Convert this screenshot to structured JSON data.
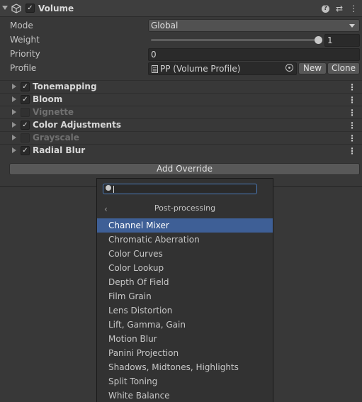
{
  "header": {
    "title": "Volume",
    "icons": [
      "volume-cube-icon",
      "help-icon",
      "preset-sliders-icon",
      "kebab-menu-icon"
    ],
    "help_glyph": "?",
    "preset_glyph": "⇄",
    "kebab_glyph": "⋮"
  },
  "fields": {
    "mode_label": "Mode",
    "mode_value": "Global",
    "weight_label": "Weight",
    "weight_value": "1",
    "priority_label": "Priority",
    "priority_value": "0",
    "profile_label": "Profile",
    "profile_value": "PP (Volume Profile)",
    "new_label": "New",
    "clone_label": "Clone"
  },
  "components": [
    {
      "label": "Tonemapping",
      "enabled": true
    },
    {
      "label": "Bloom",
      "enabled": true
    },
    {
      "label": "Vignette",
      "enabled": false
    },
    {
      "label": "Color Adjustments",
      "enabled": true
    },
    {
      "label": "Grayscale",
      "enabled": false
    },
    {
      "label": "Radial Blur",
      "enabled": true
    }
  ],
  "add_override_label": "Add Override",
  "popup": {
    "search_value": "",
    "title": "Post-processing",
    "back_glyph": "‹",
    "items": [
      "Channel Mixer",
      "Chromatic Aberration",
      "Color Curves",
      "Color Lookup",
      "Depth Of Field",
      "Film Grain",
      "Lens Distortion",
      "Lift, Gamma, Gain",
      "Motion Blur",
      "Panini Projection",
      "Shadows, Midtones, Highlights",
      "Split Toning",
      "White Balance"
    ],
    "selected_index": 0
  },
  "colors": {
    "selection": "#3e5f96",
    "panel_bg": "#383838",
    "search_focus": "#4c7ab8"
  }
}
